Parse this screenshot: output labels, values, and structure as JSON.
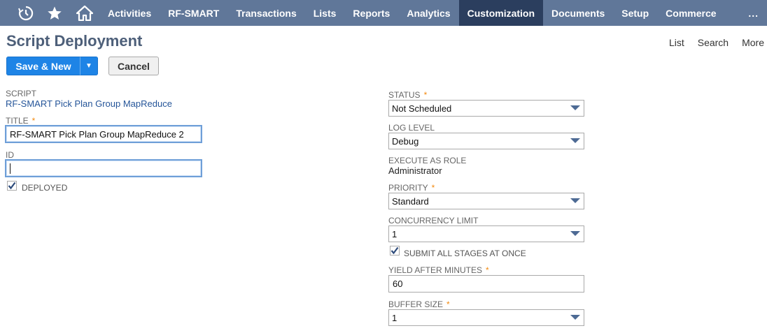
{
  "nav": {
    "icons": [
      "recent-icon",
      "star-icon",
      "home-icon"
    ],
    "items": [
      "Activities",
      "RF-SMART",
      "Transactions",
      "Lists",
      "Reports",
      "Analytics",
      "Customization",
      "Documents",
      "Setup",
      "Commerce"
    ],
    "active": "Customization",
    "more": "..."
  },
  "header": {
    "title": "Script Deployment",
    "links": [
      "List",
      "Search",
      "More"
    ]
  },
  "buttons": {
    "save_new": "Save & New",
    "cancel": "Cancel"
  },
  "left": {
    "script_label": "SCRIPT",
    "script_value": "RF-SMART Pick Plan Group MapReduce",
    "title_label": "TITLE",
    "title_required": "*",
    "title_value": "RF-SMART Pick Plan Group MapReduce 2",
    "id_label": "ID",
    "id_value": "",
    "deployed_label": "DEPLOYED",
    "deployed_checked": true
  },
  "right": {
    "status_label": "STATUS",
    "status_required": "*",
    "status_value": "Not Scheduled",
    "log_level_label": "LOG LEVEL",
    "log_level_value": "Debug",
    "execute_role_label": "EXECUTE AS ROLE",
    "execute_role_value": "Administrator",
    "priority_label": "PRIORITY",
    "priority_required": "*",
    "priority_value": "Standard",
    "concurrency_label": "CONCURRENCY LIMIT",
    "concurrency_value": "1",
    "submit_all_label": "SUBMIT ALL STAGES AT ONCE",
    "submit_all_checked": true,
    "yield_label": "YIELD AFTER MINUTES",
    "yield_required": "*",
    "yield_value": "60",
    "buffer_label": "BUFFER SIZE",
    "buffer_required": "*",
    "buffer_value": "1"
  },
  "colors": {
    "nav_bg": "#607799",
    "nav_active": "#2b3e5e",
    "primary_button": "#1e84e6",
    "title_color": "#4d5f79",
    "link_color": "#255599",
    "required_mark": "#f38a10"
  }
}
